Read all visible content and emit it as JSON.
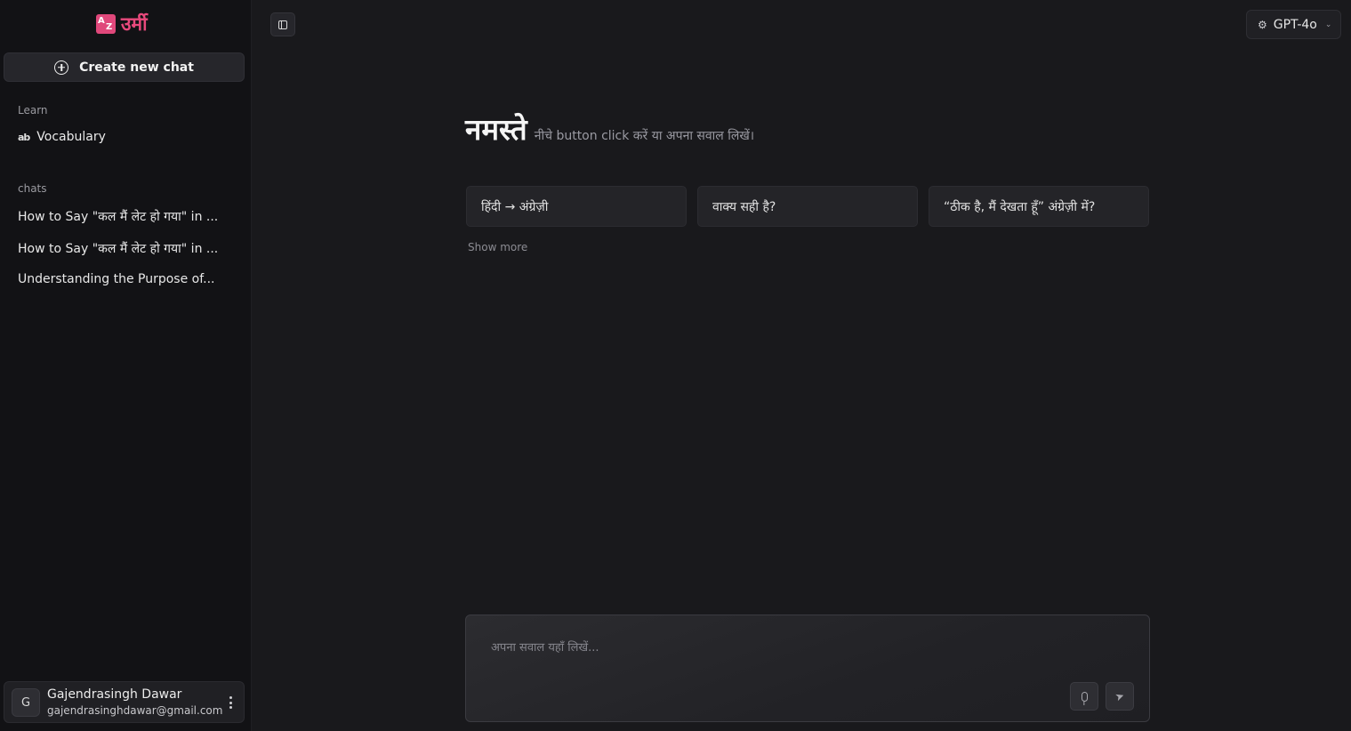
{
  "app": {
    "logo_text": "उर्मी",
    "logo_mark_letters": [
      "A",
      "Z"
    ]
  },
  "sidebar": {
    "new_chat_label": "Create new chat",
    "learn_label": "Learn",
    "vocabulary_label": "Vocabulary",
    "vocabulary_icon_text": "ab",
    "chats_label": "chats",
    "chats": [
      {
        "title": "How to Say \"कल मैं लेट हो गया\" in ..."
      },
      {
        "title": "How to Say \"कल मैं लेट हो गया\" in ..."
      },
      {
        "title": "Understanding the Purpose of..."
      }
    ],
    "user": {
      "avatar_letter": "G",
      "name": "Gajendrasingh Dawar",
      "email": "gajendrasinghdawar@gmail.com"
    }
  },
  "header": {
    "model_label": "GPT-4o"
  },
  "main": {
    "greeting": "नमस्ते",
    "subtitle": "नीचे button click करें या अपना सवाल लिखें।",
    "suggestions": [
      {
        "label": "हिंदी → अंग्रेज़ी"
      },
      {
        "label": "वाक्य सही है?"
      },
      {
        "label": "“ठीक है, मैं देखता हूँ” अंग्रेज़ी में?"
      }
    ],
    "show_more": "Show more"
  },
  "composer": {
    "placeholder": "अपना सवाल यहाँ लिखें...",
    "value": ""
  },
  "colors": {
    "background": "#19191c",
    "sidebar": "#121215",
    "accent": "#e8497c"
  }
}
